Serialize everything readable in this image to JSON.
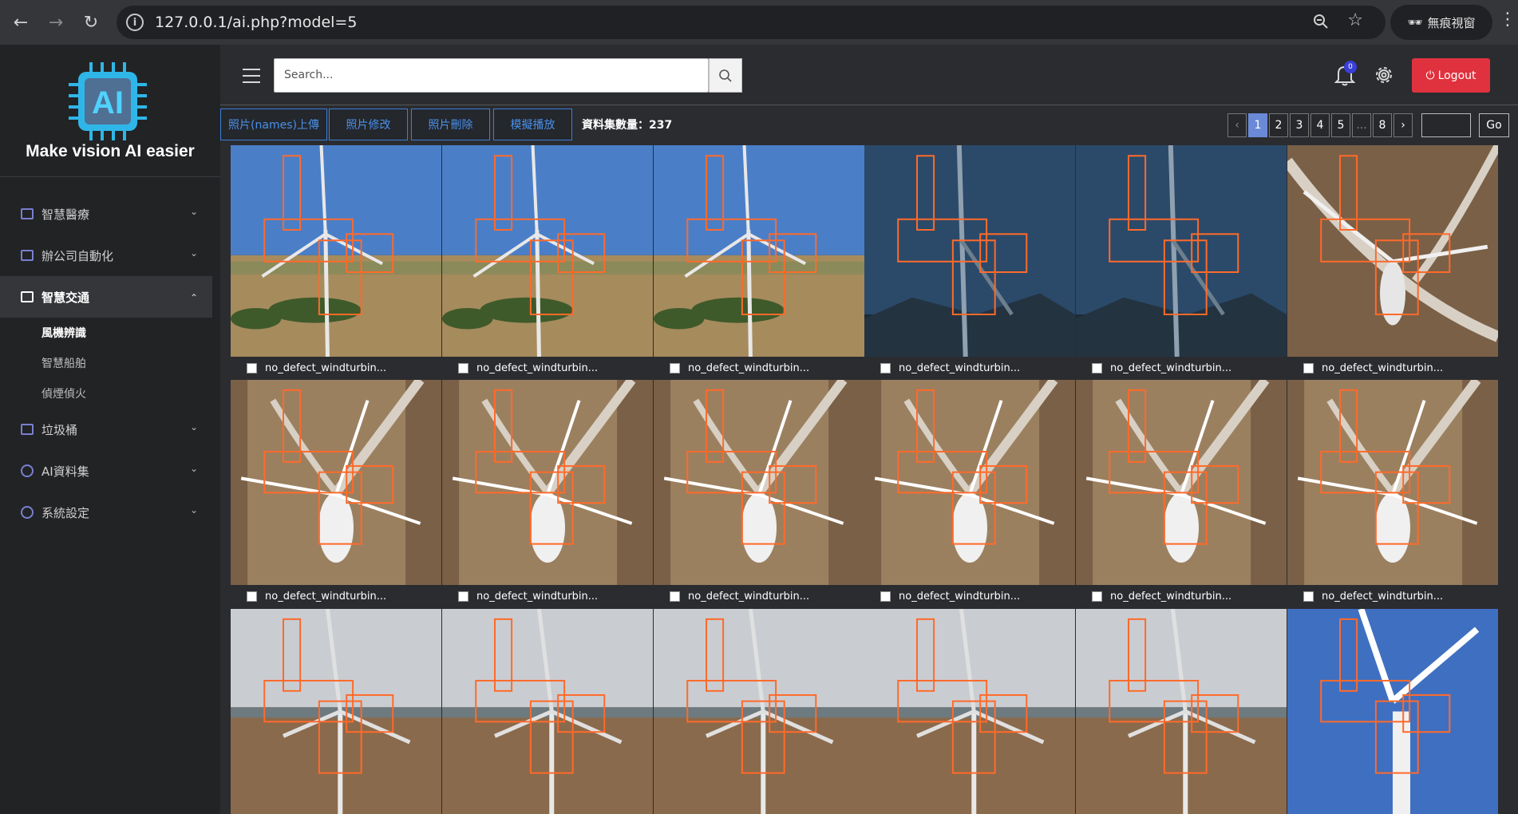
{
  "browser": {
    "url": "127.0.0.1/ai.php?model=5",
    "incognito_label": "無痕視窗"
  },
  "sidebar": {
    "brand": "Make vision AI easier",
    "logo_text": "AI",
    "items": [
      {
        "label": "智慧醫療",
        "icon": "monitor-icon"
      },
      {
        "label": "辦公司自動化",
        "icon": "monitor-icon"
      },
      {
        "label": "智慧交通",
        "icon": "monitor-icon",
        "expanded": true
      },
      {
        "label": "垃圾桶",
        "icon": "monitor-icon"
      },
      {
        "label": "AI資料集",
        "icon": "dataset-icon"
      },
      {
        "label": "系統設定",
        "icon": "settings-icon"
      }
    ],
    "subitems": [
      "風機辨識",
      "智慧船舶",
      "偵煙偵火"
    ]
  },
  "topbar": {
    "search_placeholder": "Search...",
    "notification_count": "0",
    "logout_label": "Logout"
  },
  "toolbar": {
    "buttons": [
      "照片(names)上傳",
      "照片修改",
      "照片刪除",
      "模擬播放"
    ],
    "count_label": "資料集數量：237"
  },
  "pagination": {
    "prev": "‹",
    "pages": [
      "1",
      "2",
      "3",
      "4",
      "5"
    ],
    "ellipsis": "...",
    "last": "8",
    "next": "›",
    "current": "1",
    "go_label": "Go"
  },
  "gallery": {
    "caption": "no_defect_windturbin...",
    "colors": {
      "box": "#ff6a2a",
      "sky": "#4a7fc8",
      "field": "#a68b5d",
      "dirt": "#7a6047"
    }
  }
}
